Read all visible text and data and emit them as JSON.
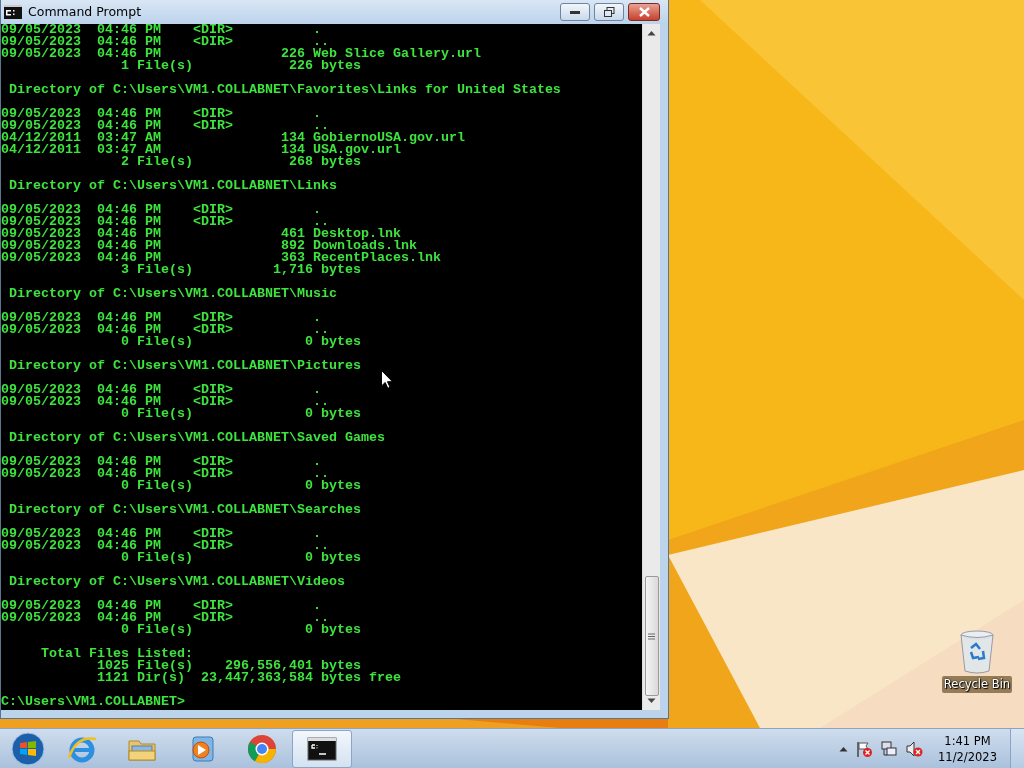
{
  "window": {
    "title": "Command Prompt"
  },
  "console": {
    "top_lines": [
      "09/05/2023  04:46 PM    <DIR>          .",
      "09/05/2023  04:46 PM    <DIR>          ..",
      "09/05/2023  04:46 PM               226 Web Slice Gallery.url",
      "               1 File(s)            226 bytes"
    ],
    "directories": [
      {
        "heading": " Directory of C:\\Users\\VM1.COLLABNET\\Favorites\\Links for United States",
        "lines": [
          "09/05/2023  04:46 PM    <DIR>          .",
          "09/05/2023  04:46 PM    <DIR>          ..",
          "04/12/2011  03:47 AM               134 GobiernoUSA.gov.url",
          "04/12/2011  03:47 AM               134 USA.gov.url",
          "               2 File(s)            268 bytes"
        ]
      },
      {
        "heading": " Directory of C:\\Users\\VM1.COLLABNET\\Links",
        "lines": [
          "09/05/2023  04:46 PM    <DIR>          .",
          "09/05/2023  04:46 PM    <DIR>          ..",
          "09/05/2023  04:46 PM               461 Desktop.lnk",
          "09/05/2023  04:46 PM               892 Downloads.lnk",
          "09/05/2023  04:46 PM               363 RecentPlaces.lnk",
          "               3 File(s)          1,716 bytes"
        ]
      },
      {
        "heading": " Directory of C:\\Users\\VM1.COLLABNET\\Music",
        "lines": [
          "09/05/2023  04:46 PM    <DIR>          .",
          "09/05/2023  04:46 PM    <DIR>          ..",
          "               0 File(s)              0 bytes"
        ]
      },
      {
        "heading": " Directory of C:\\Users\\VM1.COLLABNET\\Pictures",
        "lines": [
          "09/05/2023  04:46 PM    <DIR>          .",
          "09/05/2023  04:46 PM    <DIR>          ..",
          "               0 File(s)              0 bytes"
        ]
      },
      {
        "heading": " Directory of C:\\Users\\VM1.COLLABNET\\Saved Games",
        "lines": [
          "09/05/2023  04:46 PM    <DIR>          .",
          "09/05/2023  04:46 PM    <DIR>          ..",
          "               0 File(s)              0 bytes"
        ]
      },
      {
        "heading": " Directory of C:\\Users\\VM1.COLLABNET\\Searches",
        "lines": [
          "09/05/2023  04:46 PM    <DIR>          .",
          "09/05/2023  04:46 PM    <DIR>          ..",
          "               0 File(s)              0 bytes"
        ]
      },
      {
        "heading": " Directory of C:\\Users\\VM1.COLLABNET\\Videos",
        "lines": [
          "09/05/2023  04:46 PM    <DIR>          .",
          "09/05/2023  04:46 PM    <DIR>          ..",
          "               0 File(s)              0 bytes"
        ]
      }
    ],
    "summary": [
      "     Total Files Listed:",
      "            1025 File(s)    296,556,401 bytes",
      "            1121 Dir(s)  23,447,363,584 bytes free"
    ],
    "prompt": "C:\\Users\\VM1.COLLABNET>"
  },
  "desktop_icons": [
    {
      "label": "Recycle Bin"
    }
  ],
  "taskbar": {
    "items": [
      {
        "kind": "ie",
        "selected": false
      },
      {
        "kind": "explorer",
        "selected": false
      },
      {
        "kind": "media",
        "selected": false
      },
      {
        "kind": "chrome",
        "selected": false
      },
      {
        "kind": "cmd",
        "selected": true
      }
    ],
    "clock": {
      "time": "1:41 PM",
      "date": "11/2/2023"
    }
  }
}
